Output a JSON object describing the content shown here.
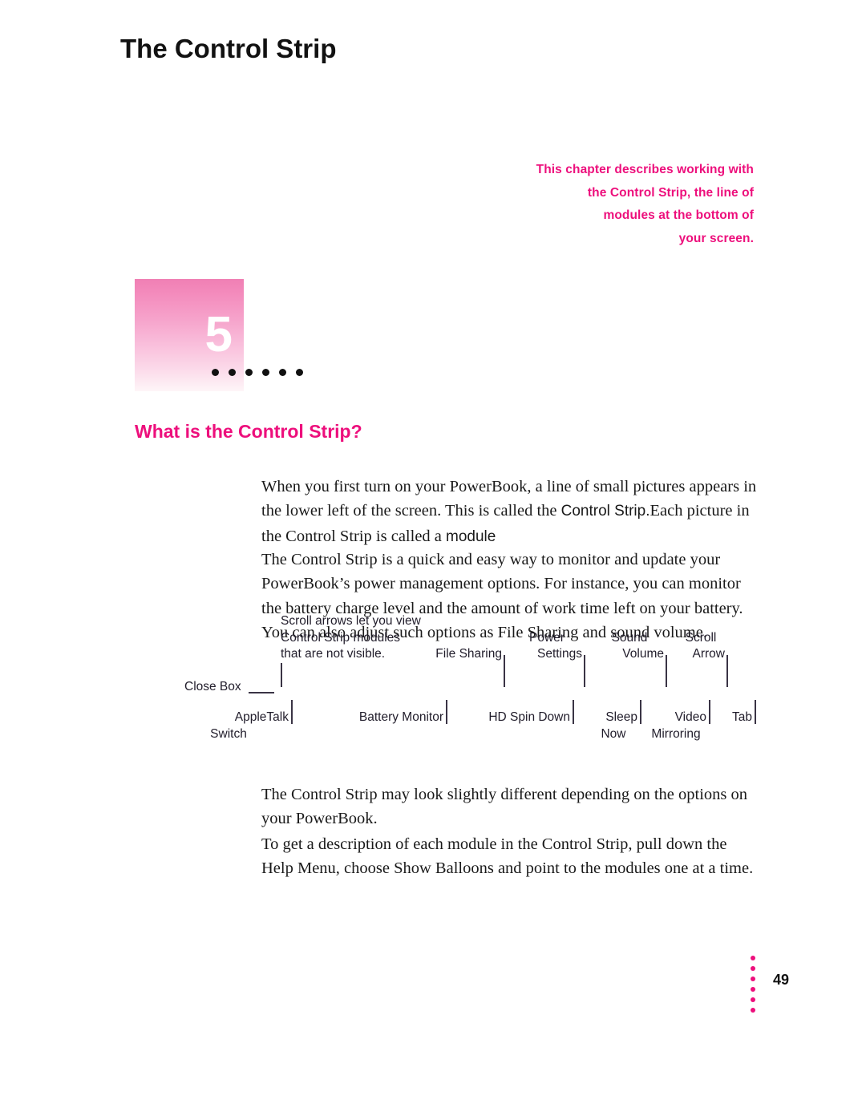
{
  "intro_blurb": {
    "lines": [
      "This chapter describes working with",
      "the Control Strip, the line of",
      "modules at the bottom of",
      "your screen."
    ]
  },
  "chapter": {
    "number": "5",
    "title": "The Control Strip",
    "dot_count": 6
  },
  "section": {
    "heading": "What is the Control Strip?"
  },
  "paragraphs": {
    "p1_a": "When you first turn on your PowerBook, a line of small pictures appears in the lower left of the screen. This is called the ",
    "p1_b": "Control Strip.",
    "p1_c": "Each picture in the Control Strip is called a ",
    "p1_d": "module",
    "p2": "The Control Strip is a quick and easy way to monitor and update your PowerBook’s power management options. For instance, you can monitor the battery charge level and the amount of work time left on your battery. You can also adjust such options as File Sharing and sound volume.",
    "p3": "The Control Strip may look slightly different depending on the options on your PowerBook.",
    "p4": "To get a description of each module in the Control Strip, pull down the Help Menu, choose Show Balloons and point to the modules one at a time."
  },
  "diagram": {
    "top_labels": [
      {
        "text": "Scroll arrows let you view"
      },
      {
        "text": "Control Strip modules"
      },
      {
        "text": "that are not visible."
      },
      {
        "text": "File Sharing"
      },
      {
        "text": "Power"
      },
      {
        "text": "Settings"
      },
      {
        "text": "Sound"
      },
      {
        "text": "Volume"
      },
      {
        "text": "Scroll"
      },
      {
        "text": "Arrow"
      }
    ],
    "close_box_label": "Close Box",
    "bottom_labels": [
      {
        "text": "AppleTalk"
      },
      {
        "text": "Switch"
      },
      {
        "text": "Battery Monitor"
      },
      {
        "text": "HD Spin Down"
      },
      {
        "text": "Sleep"
      },
      {
        "text": "Now"
      },
      {
        "text": "Video"
      },
      {
        "text": "Mirroring"
      },
      {
        "text": "Tab"
      }
    ]
  },
  "footer": {
    "page_number": "49",
    "dot_count": 6
  },
  "colors": {
    "accent_magenta": "#ED0F7C",
    "chapter_box_top": "#f07fb4",
    "chapter_box_bottom": "#fef5f8",
    "body_text": "#1a1a1a",
    "leader_line": "#3a3445"
  }
}
